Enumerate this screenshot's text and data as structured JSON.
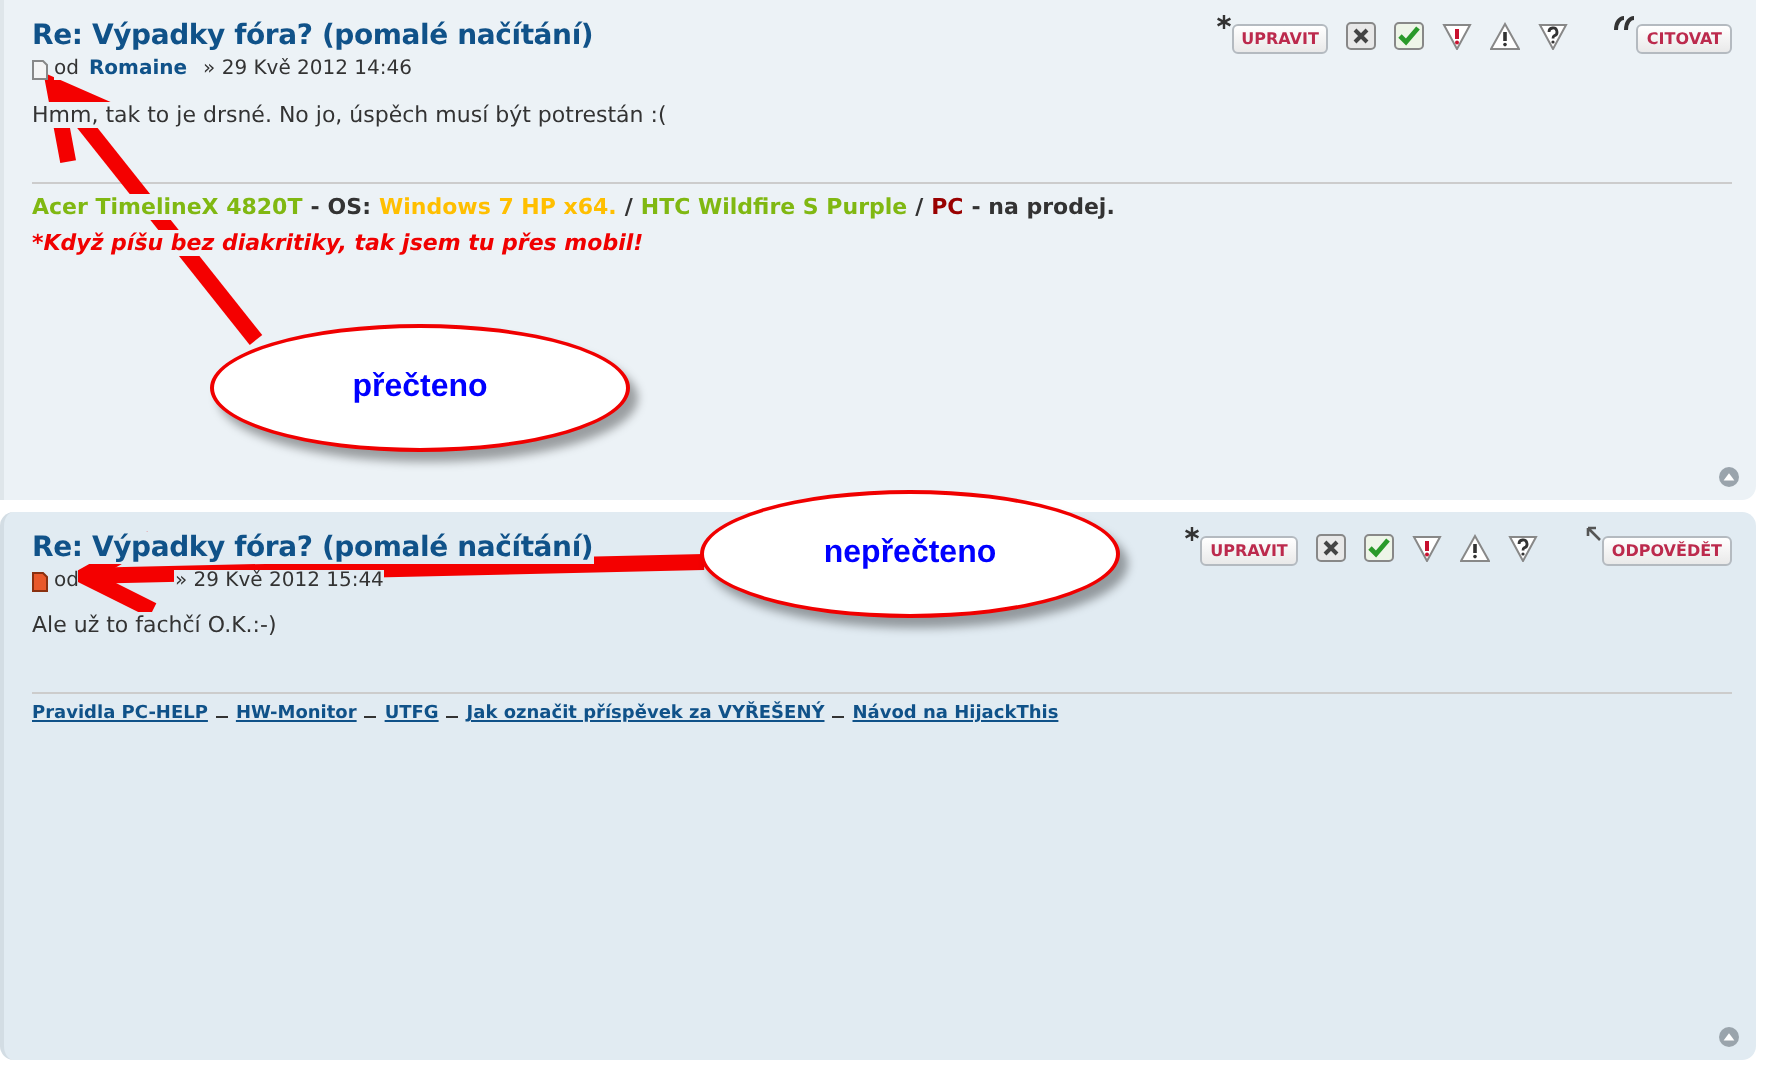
{
  "posts": [
    {
      "title": "Re: Výpadky fóra? (pomalé načítání)",
      "unread": false,
      "byline": {
        "prefix": "od",
        "author": "Romaine",
        "date": "» 29 Kvě 2012 14:46"
      },
      "buttons": [
        {
          "kind": "edit",
          "label": "UPRAVIT"
        },
        {
          "kind": "delete"
        },
        {
          "kind": "approve"
        },
        {
          "kind": "report"
        },
        {
          "kind": "warn"
        },
        {
          "kind": "info"
        },
        {
          "kind": "quote",
          "label": "CITOVAT"
        }
      ],
      "body": "Hmm, tak to je drsné. No jo, úspěch musí být potrestán :(",
      "signature": [
        {
          "kind": "segments",
          "parts": [
            {
              "text": "Acer TimelineX 4820T",
              "color": "#80b812"
            },
            {
              "text": "-",
              "color": "#333333"
            },
            {
              "text": "OS:",
              "color": "#333333"
            },
            {
              "text": "Windows 7 HP x64.",
              "color": "#ffbf00"
            },
            {
              "text": "/",
              "color": "#333333"
            },
            {
              "text": "HTC Wildfire S Purple",
              "color": "#80b812"
            },
            {
              "text": "/",
              "color": "#333333"
            },
            {
              "text": "PC",
              "color": "#990000"
            },
            {
              "text": "- na prodej.",
              "color": "#333333"
            }
          ]
        },
        {
          "kind": "note",
          "text": "*Když píšu bez diakritiky, tak jsem tu přes mobil!"
        }
      ]
    },
    {
      "title": "Re: Výpadky fóra? (pomalé načítání)",
      "unread": true,
      "byline": {
        "prefix": "od",
        "date": "» 29 Kvě 2012 15:44"
      },
      "buttons": [
        {
          "kind": "edit",
          "label": "UPRAVIT"
        },
        {
          "kind": "delete"
        },
        {
          "kind": "approve"
        },
        {
          "kind": "report"
        },
        {
          "kind": "warn"
        },
        {
          "kind": "info"
        },
        {
          "kind": "reply",
          "label": "ODPOVĚDĚT"
        }
      ],
      "body": "Ale už to fachčí O.K.:-)",
      "signature": [
        {
          "kind": "links",
          "parts": [
            {
              "text": "Pravidla PC-HELP"
            },
            {
              "text": "HW-Monitor"
            },
            {
              "text": "UTFG"
            },
            {
              "text": "Jak označit příspěvek za VYŘEŠENÝ"
            },
            {
              "text": "Návod na HijackThis"
            }
          ]
        }
      ]
    }
  ],
  "callouts": [
    {
      "text": "přečteno"
    },
    {
      "text": "nepřečteno"
    }
  ]
}
